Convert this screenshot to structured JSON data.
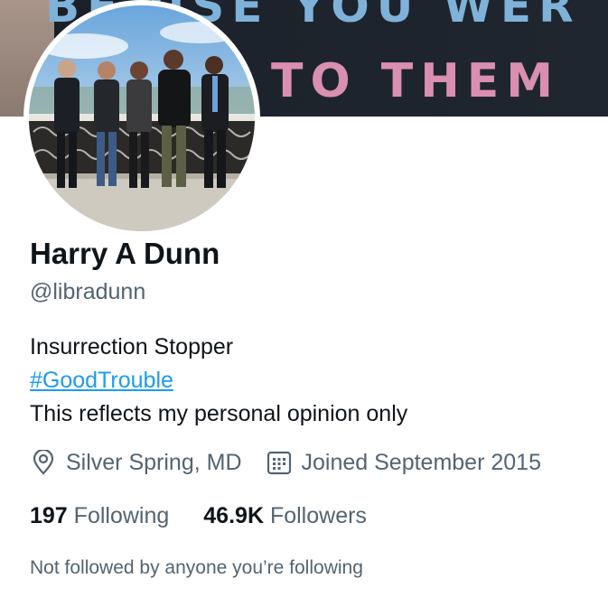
{
  "banner": {
    "line1": "BE USE YOU WER",
    "line2": "TO THEM"
  },
  "profile": {
    "name": "Harry A Dunn",
    "handle": "@libradunn",
    "bio_line1": "Insurrection Stopper",
    "bio_hashtag": "#GoodTrouble",
    "bio_line3": "This reflects my personal opinion only",
    "location": "Silver Spring, MD",
    "joined": "Joined September 2015",
    "following_count": "197",
    "following_label": "Following",
    "followers_count": "46.9K",
    "followers_label": "Followers",
    "not_followed": "Not followed by anyone you’re following"
  },
  "icons": {
    "location": "location-pin-icon",
    "calendar": "calendar-icon"
  },
  "colors": {
    "link": "#1d9bf0",
    "secondary_text": "#536471",
    "primary_text": "#0f1419"
  }
}
